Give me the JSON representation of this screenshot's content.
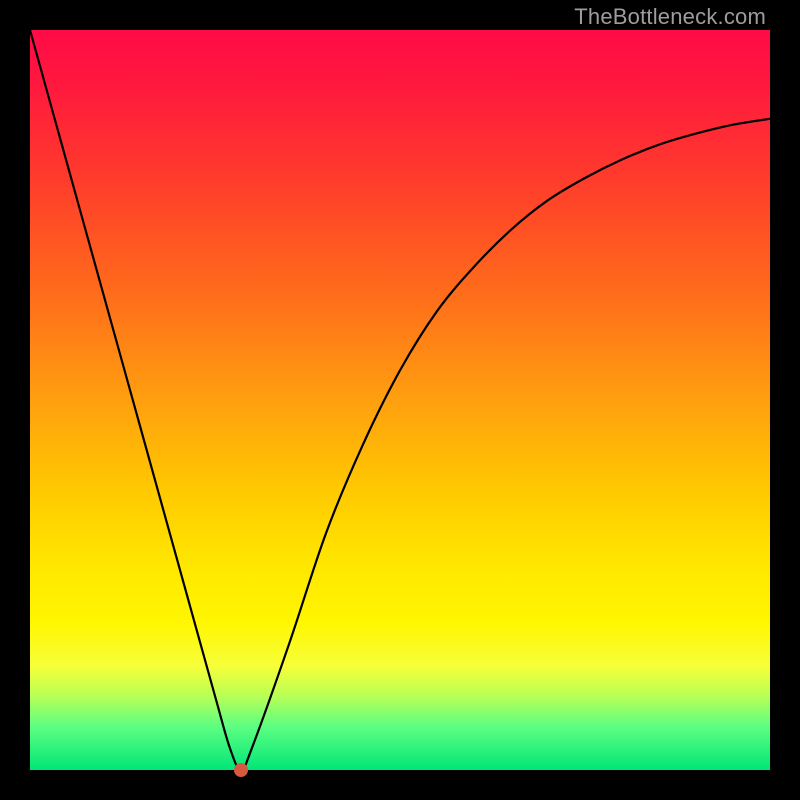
{
  "watermark": "TheBottleneck.com",
  "chart_data": {
    "type": "line",
    "title": "",
    "xlabel": "",
    "ylabel": "",
    "xlim": [
      0,
      100
    ],
    "ylim": [
      0,
      100
    ],
    "grid": false,
    "legend": false,
    "series": [
      {
        "name": "bottleneck-curve",
        "x": [
          0,
          5,
          10,
          15,
          20,
          25,
          27,
          28.5,
          30,
          35,
          40,
          45,
          50,
          55,
          60,
          65,
          70,
          75,
          80,
          85,
          90,
          95,
          100
        ],
        "values": [
          100,
          82,
          64,
          46,
          28,
          10,
          3,
          0,
          3,
          17,
          32,
          44,
          54,
          62,
          68,
          73,
          77,
          80,
          82.5,
          84.5,
          86,
          87.2,
          88
        ]
      }
    ],
    "markers": [
      {
        "name": "indicator-dot",
        "x": 28.5,
        "y": 0,
        "color": "#d65a3f"
      }
    ],
    "background_gradient": {
      "direction": "vertical",
      "stops": [
        {
          "pos": 0,
          "color": "#ff0b47"
        },
        {
          "pos": 50,
          "color": "#ff9f0f"
        },
        {
          "pos": 80,
          "color": "#fff600"
        },
        {
          "pos": 100,
          "color": "#00e676"
        }
      ]
    }
  }
}
